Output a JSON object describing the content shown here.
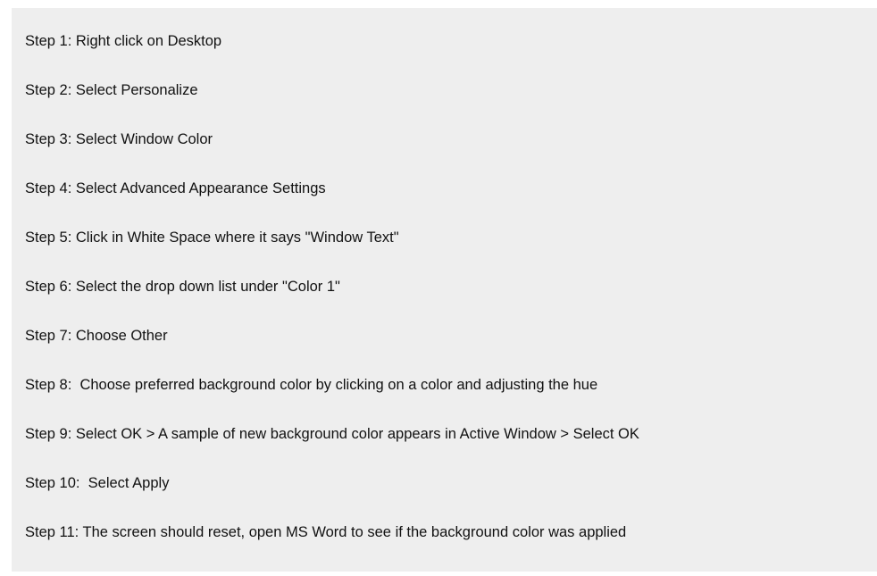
{
  "instructions": {
    "steps": [
      "Step 1: Right click on Desktop",
      "Step 2: Select Personalize",
      "Step 3: Select Window Color",
      "Step 4: Select Advanced Appearance Settings",
      "Step 5: Click in White Space where it says \"Window Text\"",
      "Step 6: Select the drop down list under \"Color 1\"",
      "Step 7: Choose Other",
      "Step 8:  Choose preferred background color by clicking on a color and adjusting the hue",
      "Step 9: Select OK > A sample of new background color appears in Active Window > Select OK",
      "Step 10:  Select Apply",
      "Step 11: The screen should reset, open MS Word to see if the background color was applied"
    ]
  },
  "colors": {
    "panel_background": "#eeeeee",
    "page_background": "#ffffff",
    "text": "#111111"
  }
}
